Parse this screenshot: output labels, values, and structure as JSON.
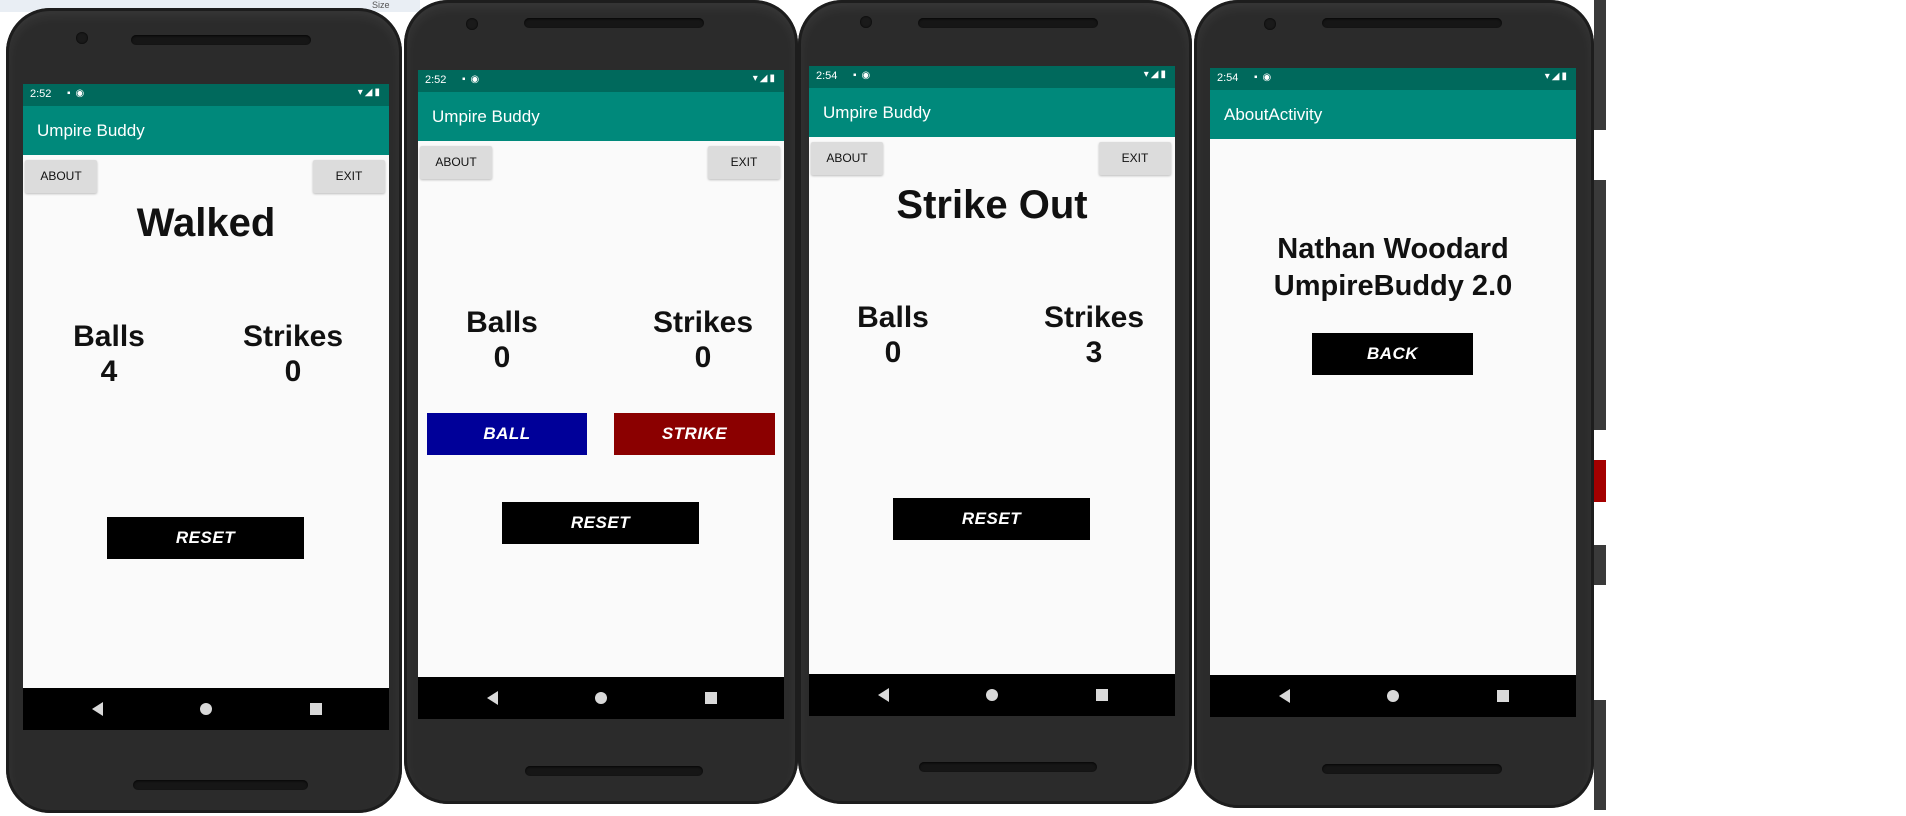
{
  "desktop": {
    "toolbar_text": "Size"
  },
  "nav": {
    "back_icon": "nav-back-icon",
    "home_icon": "nav-home-icon",
    "recent_icon": "nav-recent-icon"
  },
  "phones": [
    {
      "time": "2:52",
      "app_title": "Umpire Buddy",
      "about_label": "ABOUT",
      "exit_label": "EXIT",
      "status": "Walked",
      "balls_label": "Balls",
      "balls_value": "4",
      "strikes_label": "Strikes",
      "strikes_value": "0",
      "reset_label": "RESET"
    },
    {
      "time": "2:52",
      "app_title": "Umpire Buddy",
      "about_label": "ABOUT",
      "exit_label": "EXIT",
      "status": "",
      "balls_label": "Balls",
      "balls_value": "0",
      "strikes_label": "Strikes",
      "strikes_value": "0",
      "ball_label": "BALL",
      "strike_label": "STRIKE",
      "reset_label": "RESET"
    },
    {
      "time": "2:54",
      "app_title": "Umpire Buddy",
      "about_label": "ABOUT",
      "exit_label": "EXIT",
      "status": "Strike Out",
      "balls_label": "Balls",
      "balls_value": "0",
      "strikes_label": "Strikes",
      "strikes_value": "3",
      "reset_label": "RESET"
    },
    {
      "time": "2:54",
      "app_title": "AboutActivity",
      "author": "Nathan Woodard",
      "version": "UmpireBuddy 2.0",
      "back_label": "BACK"
    }
  ],
  "colors": {
    "status_bar": "#00695c",
    "app_bar": "#00897b",
    "ball_button": "#000099",
    "strike_button": "#8b0000",
    "reset_button": "#000000"
  }
}
